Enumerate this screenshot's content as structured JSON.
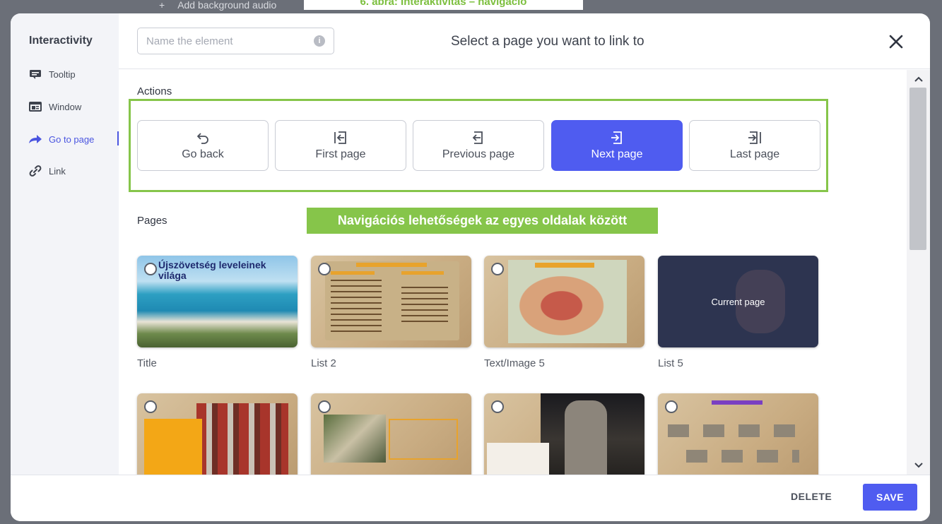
{
  "backdrop": {
    "audio_plus": "+",
    "audio_label": "Add background audio",
    "banner_text": "6. ábra: Interaktivitás – navigáció"
  },
  "sidebar": {
    "title": "Interactivity",
    "items": [
      {
        "label": "Tooltip",
        "icon": "tooltip-icon"
      },
      {
        "label": "Window",
        "icon": "window-icon"
      },
      {
        "label": "Go to page",
        "icon": "arrow-right-icon",
        "active": true
      },
      {
        "label": "Link",
        "icon": "link-icon"
      }
    ]
  },
  "header": {
    "name_placeholder": "Name the element",
    "name_value": "",
    "info_glyph": "i",
    "title": "Select a page you want to link to"
  },
  "actions": {
    "label": "Actions",
    "buttons": [
      {
        "label": "Go back",
        "icon": "undo-icon"
      },
      {
        "label": "First page",
        "icon": "first-page-icon"
      },
      {
        "label": "Previous page",
        "icon": "previous-page-icon"
      },
      {
        "label": "Next page",
        "icon": "next-page-icon",
        "selected": true
      },
      {
        "label": "Last page",
        "icon": "last-page-icon"
      }
    ]
  },
  "annotation": {
    "text": "Navigációs lehetőségek az egyes oldalak között"
  },
  "pages": {
    "label": "Pages",
    "items": [
      {
        "label": "Title",
        "thumb_title": "Újszövetség leveleinek világa"
      },
      {
        "label": "List 2"
      },
      {
        "label": "Text/Image 5"
      },
      {
        "label": "List 5",
        "overlay": "Current page",
        "current": true
      },
      {
        "label": ""
      },
      {
        "label": ""
      },
      {
        "label": ""
      },
      {
        "label": ""
      }
    ]
  },
  "footer": {
    "delete_label": "DELETE",
    "save_label": "SAVE"
  },
  "colors": {
    "accent": "#4f5cf0",
    "highlight": "#86c54a",
    "sidebar_bg": "#f3f4f8"
  }
}
